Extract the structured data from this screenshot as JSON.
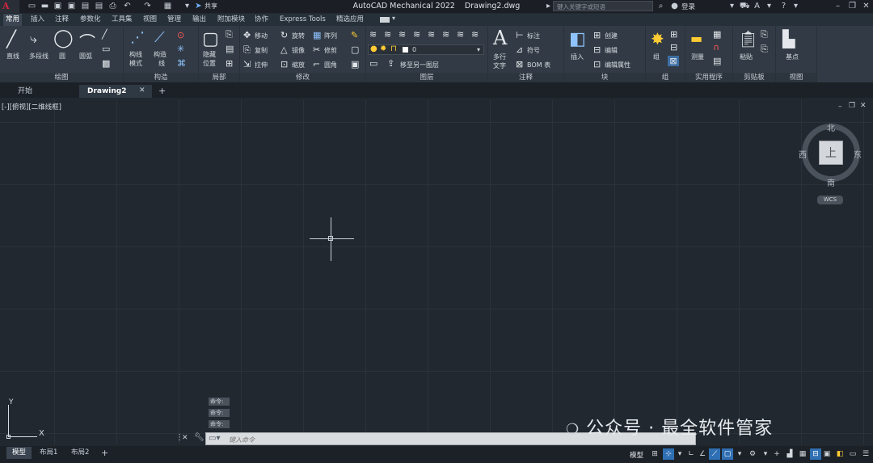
{
  "app": {
    "title": "AutoCAD Mechanical 2022",
    "document": "Drawing2.dwg",
    "logo_letter": "A",
    "share_label": "共享",
    "search_placeholder": "键入关键字或短语",
    "login_label": "登录"
  },
  "menu_tabs": [
    "常用",
    "插入",
    "注释",
    "参数化",
    "工具集",
    "视图",
    "管理",
    "输出",
    "附加模块",
    "协作",
    "Express Tools",
    "精选应用"
  ],
  "ribbon": {
    "draw": {
      "title": "绘图",
      "line": "直线",
      "polyline": "多段线",
      "circle": "圆",
      "arc": "圆弧"
    },
    "construct": {
      "title": "构造",
      "construction_mode": "构线",
      "construction_mode2": "模式",
      "calc_line": "构造",
      "calc_line2": "线"
    },
    "detail": {
      "title": "局部",
      "hide": "隐藏",
      "position": "位置"
    },
    "modify": {
      "title": "修改",
      "move": "移动",
      "rotate": "旋转",
      "array": "阵列",
      "copy": "复制",
      "mirror": "镜像",
      "trim": "修剪",
      "stretch": "拉伸",
      "scale": "缩放",
      "fillet": "圆角"
    },
    "layers": {
      "title": "图层",
      "current_layer": "0",
      "move_to_layer": "移至另一图层"
    },
    "annotation": {
      "title": "注释",
      "mtext": "多行",
      "mtext2": "文字",
      "dimension": "标注",
      "symbol": "符号",
      "bom": "BOM 表"
    },
    "block": {
      "title": "块",
      "insert": "插入",
      "create": "创建",
      "edit": "编辑",
      "edit_attr": "编辑属性"
    },
    "group": {
      "title": "组",
      "group": "组"
    },
    "utilities": {
      "title": "实用程序",
      "measure": "测量"
    },
    "clipboard": {
      "title": "剪贴板",
      "paste": "粘贴"
    },
    "view": {
      "title": "视图",
      "base": "基点"
    }
  },
  "doc_tabs": {
    "start": "开始",
    "drawing": "Drawing2",
    "add": "+"
  },
  "canvas": {
    "view_label": "[-][俯视][二维线框]",
    "compass": {
      "north": "北",
      "south": "南",
      "east": "东",
      "west": "西",
      "top": "上"
    },
    "wcs": "WCS",
    "ucs_x": "X",
    "ucs_y": "Y"
  },
  "command": {
    "history": [
      "命令:",
      "命令:",
      "命令:"
    ],
    "placeholder": "键入命令"
  },
  "watermark": "公众号 · 最全软件管家",
  "layout_tabs": [
    "模型",
    "布局1",
    "布局2"
  ],
  "status": {
    "model_label": "模型"
  }
}
